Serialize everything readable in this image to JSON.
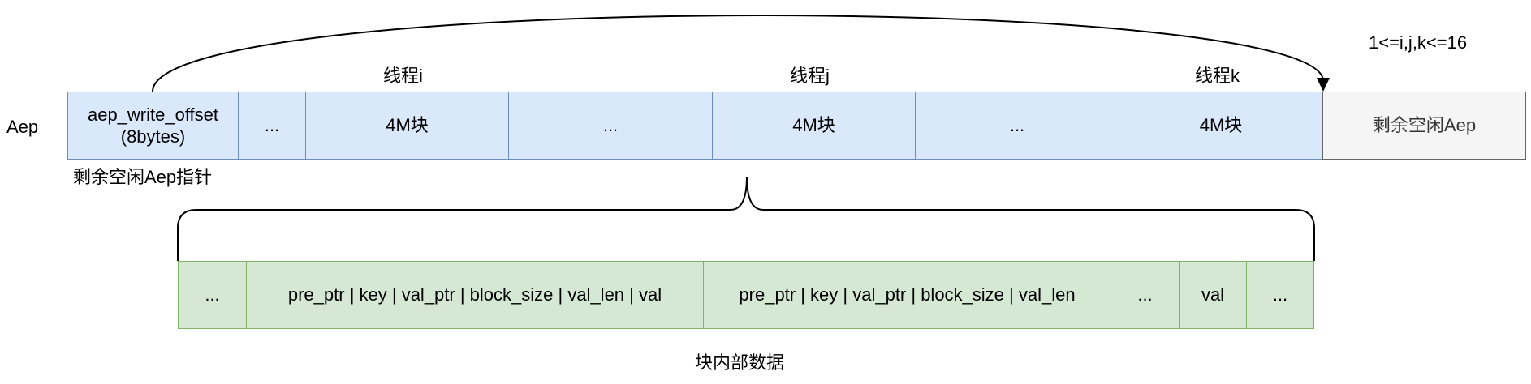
{
  "row_label": "Aep",
  "range_note": "1<=i,j,k<=16",
  "thread_labels": [
    "线程i",
    "线程j",
    "线程k"
  ],
  "pointer_label": "剩余空闲Aep指针",
  "aep_cells": [
    "aep_write_offset\n(8bytes)",
    "...",
    "4M块",
    "...",
    "4M块",
    "...",
    "4M块",
    "剩余空闲Aep"
  ],
  "block_cells": [
    "...",
    "pre_ptr | key | val_ptr | block_size | val_len | val",
    "pre_ptr | key | val_ptr | block_size | val_len",
    "...",
    "val",
    "..."
  ],
  "block_caption": "块内部数据",
  "colors": {
    "cell_fill": "#dae8fc",
    "cell_stroke": "#6c8ebf",
    "free_fill": "#f5f5f5",
    "free_stroke": "#666666",
    "block_fill": "#d5e8d4",
    "block_stroke": "#82b366"
  }
}
